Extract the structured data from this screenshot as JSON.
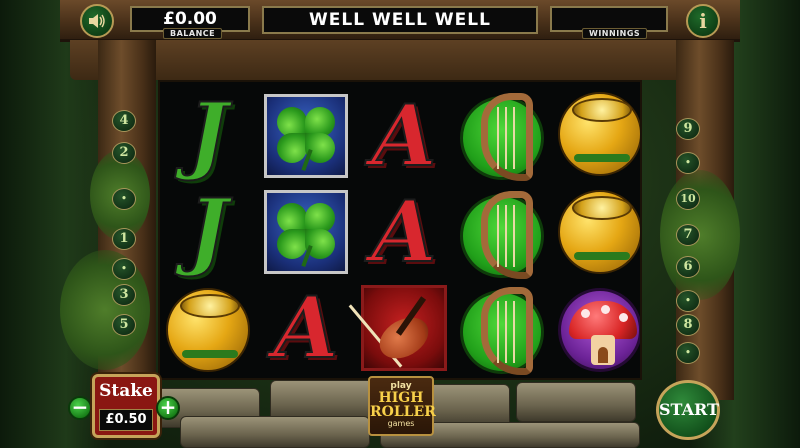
{
  "header": {
    "balance_value": "£0.00",
    "balance_label": "BALANCE",
    "title": "WELL WELL WELL",
    "winnings_value": "",
    "winnings_label": "WINNINGS",
    "sound_icon": "speaker-icon",
    "info_icon": "info-icon",
    "info_glyph": "i"
  },
  "paylines": {
    "left": [
      "4",
      "2",
      "•",
      "1",
      "•",
      "3",
      "5"
    ],
    "right": [
      "9",
      "•",
      "10",
      "7",
      "6",
      "•",
      "8",
      "•"
    ]
  },
  "reels": [
    [
      "letter-j",
      "letter-j",
      "pot-of-gold"
    ],
    [
      "four-leaf-clover",
      "four-leaf-clover",
      "letter-a"
    ],
    [
      "letter-a",
      "letter-a",
      "violin"
    ],
    [
      "harp",
      "harp",
      "harp"
    ],
    [
      "pot-of-gold",
      "pot-of-gold",
      "mushroom-house"
    ]
  ],
  "symbol_text": {
    "letter-j": "J",
    "letter-a": "A"
  },
  "controls": {
    "stake_label": "Stake",
    "stake_value": "£0.50",
    "minus_label": "−",
    "plus_label": "+",
    "start_label": "START",
    "high_roller_play": "play",
    "high_roller_main_1": "HIGH",
    "high_roller_main_2": "ROLLER",
    "high_roller_games": "games"
  },
  "colors": {
    "accent_gold": "#c6a45a",
    "stake_red": "#8a1712",
    "button_green": "#137513"
  }
}
